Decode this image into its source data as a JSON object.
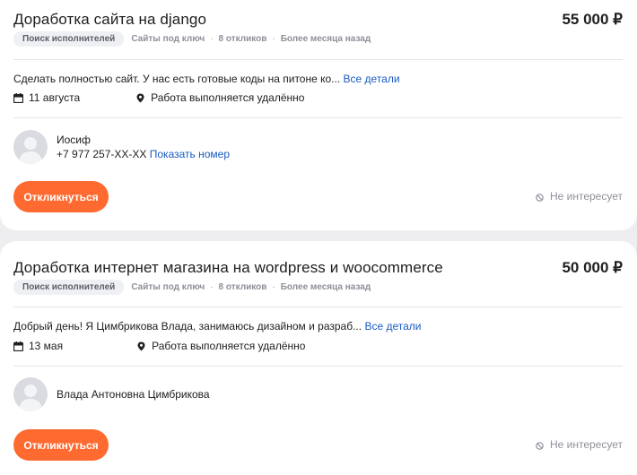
{
  "currency": "₽",
  "colors": {
    "accent": "#ff6a30",
    "link": "#1a5ac1",
    "badge_bg": "#eef0f4"
  },
  "jobs": [
    {
      "title": "Доработка сайта на django",
      "price": "55 000 ₽",
      "badge": "Поиск исполнителей",
      "type": "Сайты под ключ",
      "responses": "8 откликов",
      "age": "Более месяца назад",
      "description": "Сделать полностью сайт. У нас есть готовые коды на питоне ко...",
      "details_link": "Все детали",
      "date": "11 августа",
      "location": "Работа выполняется удалённо",
      "contact_name": "Иосиф",
      "phone": "+7 977 257-XX-XX",
      "show_number": "Показать номер",
      "respond_label": "Откликнуться",
      "not_interested_label": "Не интересует"
    },
    {
      "title": "Доработка интернет магазина на wordpress и woocommerce",
      "price": "50 000 ₽",
      "badge": "Поиск исполнителей",
      "type": "Сайты под ключ",
      "responses": "8 откликов",
      "age": "Более месяца назад",
      "description": "Добрый день! Я Цимбрикова Влада, занимаюсь дизайном и разраб...",
      "details_link": "Все детали",
      "date": "13 мая",
      "location": "Работа выполняется удалённо",
      "contact_name": "Влада Антоновна Цимбрикова",
      "respond_label": "Откликнуться",
      "not_interested_label": "Не интересует"
    }
  ]
}
